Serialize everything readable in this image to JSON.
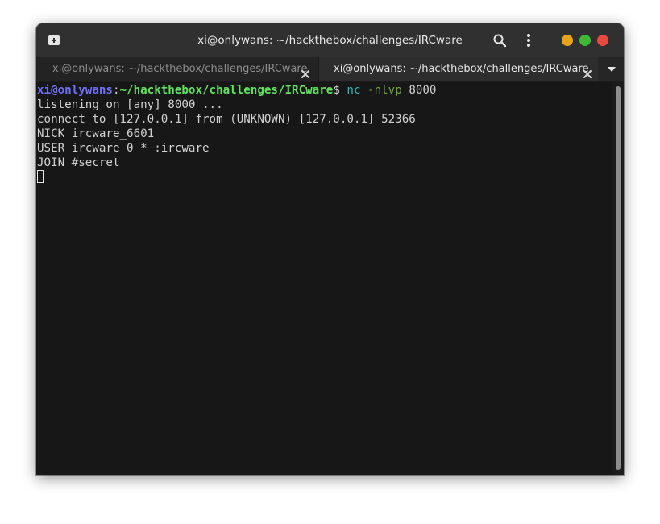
{
  "window": {
    "title": "xi@onlywans: ~/hackthebox/challenges/IRCware"
  },
  "header": {
    "new_tab_icon": "new-tab-icon",
    "search_icon": "search-icon",
    "menu_icon": "vertical-dots-icon",
    "controls": {
      "minimize_color": "#e6a419",
      "maximize_color": "#3fb835",
      "close_color": "#e9483e"
    }
  },
  "tabs": [
    {
      "label": "xi@onlywans: ~/hackthebox/challenges/IRCware",
      "active": false
    },
    {
      "label": "xi@onlywans: ~/hackthebox/challenges/IRCware",
      "active": true
    }
  ],
  "terminal": {
    "prompt": {
      "user": "xi@onlywans",
      "sep": ":",
      "path": "~/hackthebox/challenges/IRCware",
      "symbol": "$ ",
      "cmd": "nc",
      "flag": "-nlvp",
      "arg": "8000"
    },
    "lines": [
      "listening on [any] 8000 ...",
      "connect to [127.0.0.1] from (UNKNOWN) [127.0.0.1] 52366",
      "NICK ircware_6601",
      "USER ircware 0 * :ircware",
      "JOIN #secret"
    ]
  }
}
